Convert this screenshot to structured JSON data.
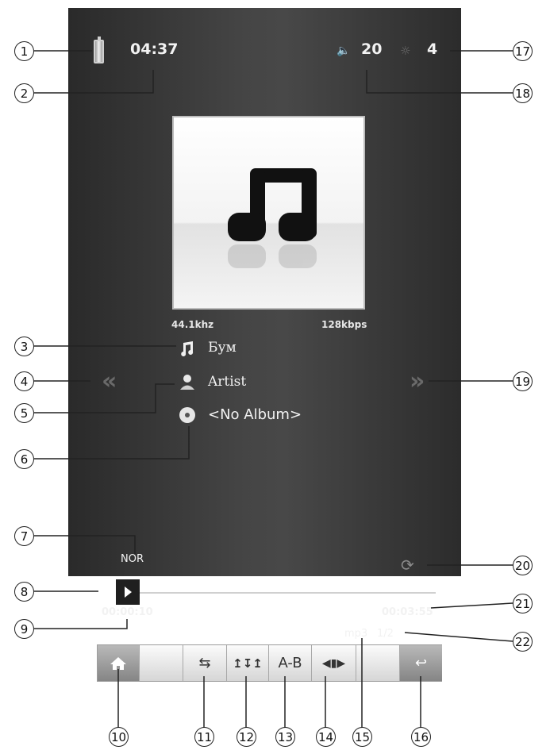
{
  "status_bar": {
    "time": "04:37",
    "volume": "20",
    "brightness": "4",
    "battery_icon": "battery-icon",
    "volume_icon": "speaker-icon",
    "brightness_icon": "sun-icon"
  },
  "now_playing": {
    "sample_rate": "44.1khz",
    "bitrate": "128kbps",
    "song": "Бум",
    "artist": "Artist",
    "album": "<No Album>"
  },
  "playback": {
    "eq_mode": "NOR",
    "elapsed": "00:00:10",
    "total": "00:03:55",
    "format": "mp3",
    "track_count": "1/2",
    "progress": 0.04
  },
  "toolbar": {
    "ab_label": "A-B"
  },
  "callouts": [
    "1",
    "2",
    "3",
    "4",
    "5",
    "6",
    "7",
    "8",
    "9",
    "10",
    "11",
    "12",
    "13",
    "14",
    "15",
    "16",
    "17",
    "18",
    "19",
    "20",
    "21",
    "22"
  ]
}
